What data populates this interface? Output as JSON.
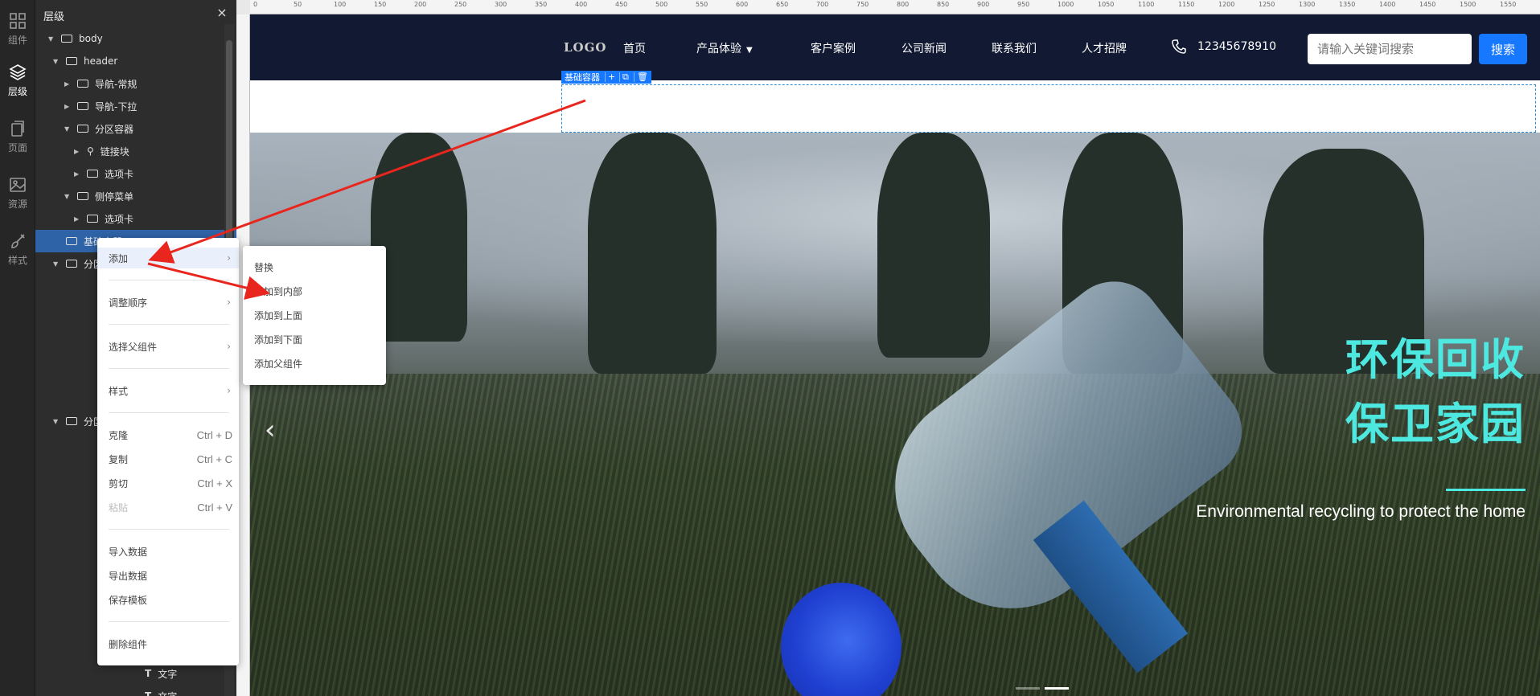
{
  "rail": {
    "items": [
      {
        "label": "组件",
        "icon": "grid-icon"
      },
      {
        "label": "层级",
        "icon": "layers-icon"
      },
      {
        "label": "页面",
        "icon": "page-icon"
      },
      {
        "label": "资源",
        "icon": "image-icon"
      },
      {
        "label": "样式",
        "icon": "brush-icon"
      }
    ]
  },
  "layers": {
    "title": "层级",
    "close": "×",
    "tree": [
      {
        "label": "body"
      },
      {
        "label": "header"
      },
      {
        "label": "导航-常规"
      },
      {
        "label": "导航-下拉"
      },
      {
        "label": "分区容器"
      },
      {
        "label": "链接块"
      },
      {
        "label": "选项卡"
      },
      {
        "label": "侧停菜单"
      },
      {
        "label": "选项卡"
      },
      {
        "label": "基础容器"
      },
      {
        "label": "分区容器"
      },
      {
        "label": "分区容器"
      },
      {
        "label": "文字"
      },
      {
        "label": "文字"
      }
    ]
  },
  "ruler": {
    "ticks": [
      "0",
      "50",
      "100",
      "150",
      "200",
      "250",
      "300",
      "350",
      "400",
      "450",
      "500",
      "550",
      "600",
      "650",
      "700",
      "750",
      "800",
      "850",
      "900",
      "950",
      "1000",
      "1050",
      "1100",
      "1150",
      "1200",
      "1250",
      "1300",
      "1350",
      "1400",
      "1450",
      "1500",
      "1550"
    ]
  },
  "site": {
    "logo": "LOGO",
    "nav": [
      "首页",
      "产品体验",
      "客户案例",
      "公司新闻",
      "联系我们",
      "人才招牌"
    ],
    "phone": "12345678910",
    "search_placeholder": "请输入关键词搜索",
    "search_button": "搜索",
    "selected_component": "基础容器",
    "toolbar_add": "+",
    "hero": {
      "title1": "环保回收",
      "title2": "保卫家园",
      "subtitle": "Environmental recycling to protect the home",
      "prev": "‹"
    }
  },
  "context_menu": {
    "items": [
      {
        "label": "添加",
        "chevron": "›"
      },
      {
        "label": "调整顺序",
        "chevron": "›"
      },
      {
        "label": "选择父组件",
        "chevron": "›"
      },
      {
        "label": "样式",
        "chevron": "›"
      },
      {
        "label": "克隆",
        "shortcut": "Ctrl + D"
      },
      {
        "label": "复制",
        "shortcut": "Ctrl + C"
      },
      {
        "label": "剪切",
        "shortcut": "Ctrl + X"
      },
      {
        "label": "粘贴",
        "shortcut": "Ctrl + V"
      },
      {
        "label": "导入数据"
      },
      {
        "label": "导出数据"
      },
      {
        "label": "保存模板"
      },
      {
        "label": "删除组件"
      }
    ]
  },
  "submenu": {
    "items": [
      "替换",
      "添加到内部",
      "添加到上面",
      "添加到下面",
      "添加父组件"
    ]
  },
  "colors": {
    "accent": "#1677ff",
    "hero_title": "#4de8e0",
    "header_bg": "#121a33",
    "selection": "#2f63a8",
    "arrow": "#e8261d"
  }
}
